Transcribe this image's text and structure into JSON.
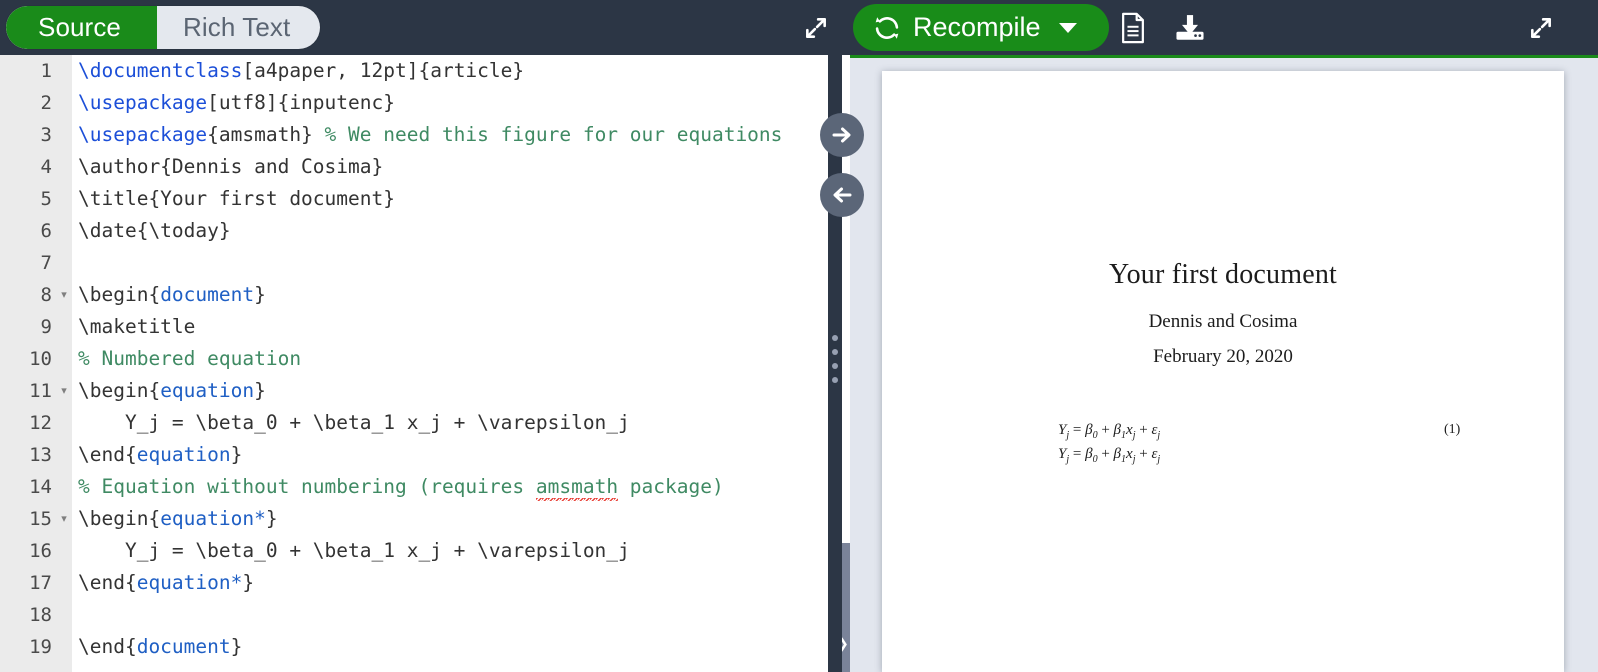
{
  "toolbar": {
    "mode_tabs": [
      {
        "label": "Source",
        "active": true
      },
      {
        "label": "Rich Text",
        "active": false
      }
    ],
    "expand_left_icon": "expand-arrows-icon",
    "expand_right_icon": "expand-arrows-icon",
    "recompile_label": "Recompile",
    "recompile_icon": "refresh-icon",
    "recompile_caret_icon": "chevron-down-icon",
    "recompile_color": "#198c19",
    "doc_icon": "document-icon",
    "download_icon": "download-icon",
    "bar_color": "#2c3645"
  },
  "editor": {
    "lines": [
      {
        "n": "1",
        "fold": "",
        "tokens": [
          {
            "t": "cmd",
            "s": "\\documentclass"
          },
          {
            "t": "txt",
            "s": "[a4paper, 12pt]{article}"
          }
        ]
      },
      {
        "n": "2",
        "fold": "",
        "tokens": [
          {
            "t": "cmd",
            "s": "\\usepackage"
          },
          {
            "t": "txt",
            "s": "[utf8]{inputenc}"
          }
        ]
      },
      {
        "n": "3",
        "fold": "",
        "tokens": [
          {
            "t": "cmd",
            "s": "\\usepackage"
          },
          {
            "t": "txt",
            "s": "{amsmath} "
          },
          {
            "t": "com",
            "s": "% We need this figure for our equations"
          }
        ]
      },
      {
        "n": "4",
        "fold": "",
        "tokens": [
          {
            "t": "txt",
            "s": "\\author{Dennis and Cosima}"
          }
        ]
      },
      {
        "n": "5",
        "fold": "",
        "tokens": [
          {
            "t": "txt",
            "s": "\\title{Your first document}"
          }
        ]
      },
      {
        "n": "6",
        "fold": "",
        "tokens": [
          {
            "t": "txt",
            "s": "\\date{\\today}"
          }
        ]
      },
      {
        "n": "7",
        "fold": "",
        "tokens": [
          {
            "t": "txt",
            "s": ""
          }
        ]
      },
      {
        "n": "8",
        "fold": "▾",
        "tokens": [
          {
            "t": "txt",
            "s": "\\begin{"
          },
          {
            "t": "env",
            "s": "document"
          },
          {
            "t": "txt",
            "s": "}"
          }
        ]
      },
      {
        "n": "9",
        "fold": "",
        "tokens": [
          {
            "t": "txt",
            "s": "\\maketitle"
          }
        ]
      },
      {
        "n": "10",
        "fold": "",
        "tokens": [
          {
            "t": "com",
            "s": "% Numbered equation"
          }
        ]
      },
      {
        "n": "11",
        "fold": "▾",
        "tokens": [
          {
            "t": "txt",
            "s": "\\begin{"
          },
          {
            "t": "env",
            "s": "equation"
          },
          {
            "t": "txt",
            "s": "}"
          }
        ]
      },
      {
        "n": "12",
        "fold": "",
        "tokens": [
          {
            "t": "txt",
            "s": "    Y_j = \\beta_0 + \\beta_1 x_j + \\varepsilon_j"
          }
        ]
      },
      {
        "n": "13",
        "fold": "",
        "tokens": [
          {
            "t": "txt",
            "s": "\\end{"
          },
          {
            "t": "env",
            "s": "equation"
          },
          {
            "t": "txt",
            "s": "}"
          }
        ]
      },
      {
        "n": "14",
        "fold": "",
        "tokens": [
          {
            "t": "com",
            "s": "% Equation without numbering (requires "
          },
          {
            "t": "com-spell",
            "s": "amsmath"
          },
          {
            "t": "com",
            "s": " package)"
          }
        ]
      },
      {
        "n": "15",
        "fold": "▾",
        "tokens": [
          {
            "t": "txt",
            "s": "\\begin{"
          },
          {
            "t": "env",
            "s": "equation*"
          },
          {
            "t": "txt",
            "s": "}"
          }
        ]
      },
      {
        "n": "16",
        "fold": "",
        "tokens": [
          {
            "t": "txt",
            "s": "    Y_j = \\beta_0 + \\beta_1 x_j + \\varepsilon_j"
          }
        ]
      },
      {
        "n": "17",
        "fold": "",
        "tokens": [
          {
            "t": "txt",
            "s": "\\end{"
          },
          {
            "t": "env",
            "s": "equation*"
          },
          {
            "t": "txt",
            "s": "}"
          }
        ]
      },
      {
        "n": "18",
        "fold": "",
        "tokens": [
          {
            "t": "txt",
            "s": ""
          }
        ]
      },
      {
        "n": "19",
        "fold": "",
        "tokens": [
          {
            "t": "txt",
            "s": "\\end{"
          },
          {
            "t": "env",
            "s": "document"
          },
          {
            "t": "txt",
            "s": "}"
          }
        ]
      }
    ],
    "gutter_color": "#ebebeb",
    "command_color": "#1c4fd8",
    "comment_color": "#3f8a63",
    "text_color": "#333333",
    "spell_underline_color": "#e8433a"
  },
  "divider": {
    "nav_right_icon": "arrow-right-icon",
    "nav_left_icon": "arrow-left-icon",
    "grip_icon": "drag-grip-icon",
    "color": "#2c3645"
  },
  "pdf_preview": {
    "background": "#e2e6ee",
    "accent_color": "#1a8b1a",
    "title": "Your first document",
    "author": "Dennis and Cosima",
    "date": "February 20, 2020",
    "equations": [
      {
        "lhs": "Y",
        "lhs_sub": "j",
        "body": "= β",
        "eqnum": "(1)"
      },
      {
        "lhs": "Y",
        "lhs_sub": "j",
        "body": "= β",
        "eqnum": ""
      }
    ],
    "equation_1_text": "Yj = β0 + β1xj + εj",
    "equation_2_text": "Yj = β0 + β1xj + εj",
    "equation_number": "(1)"
  },
  "scrollbar": {
    "chevron_icon": "chevron-right-icon",
    "thumb_color": "#7a8399"
  }
}
